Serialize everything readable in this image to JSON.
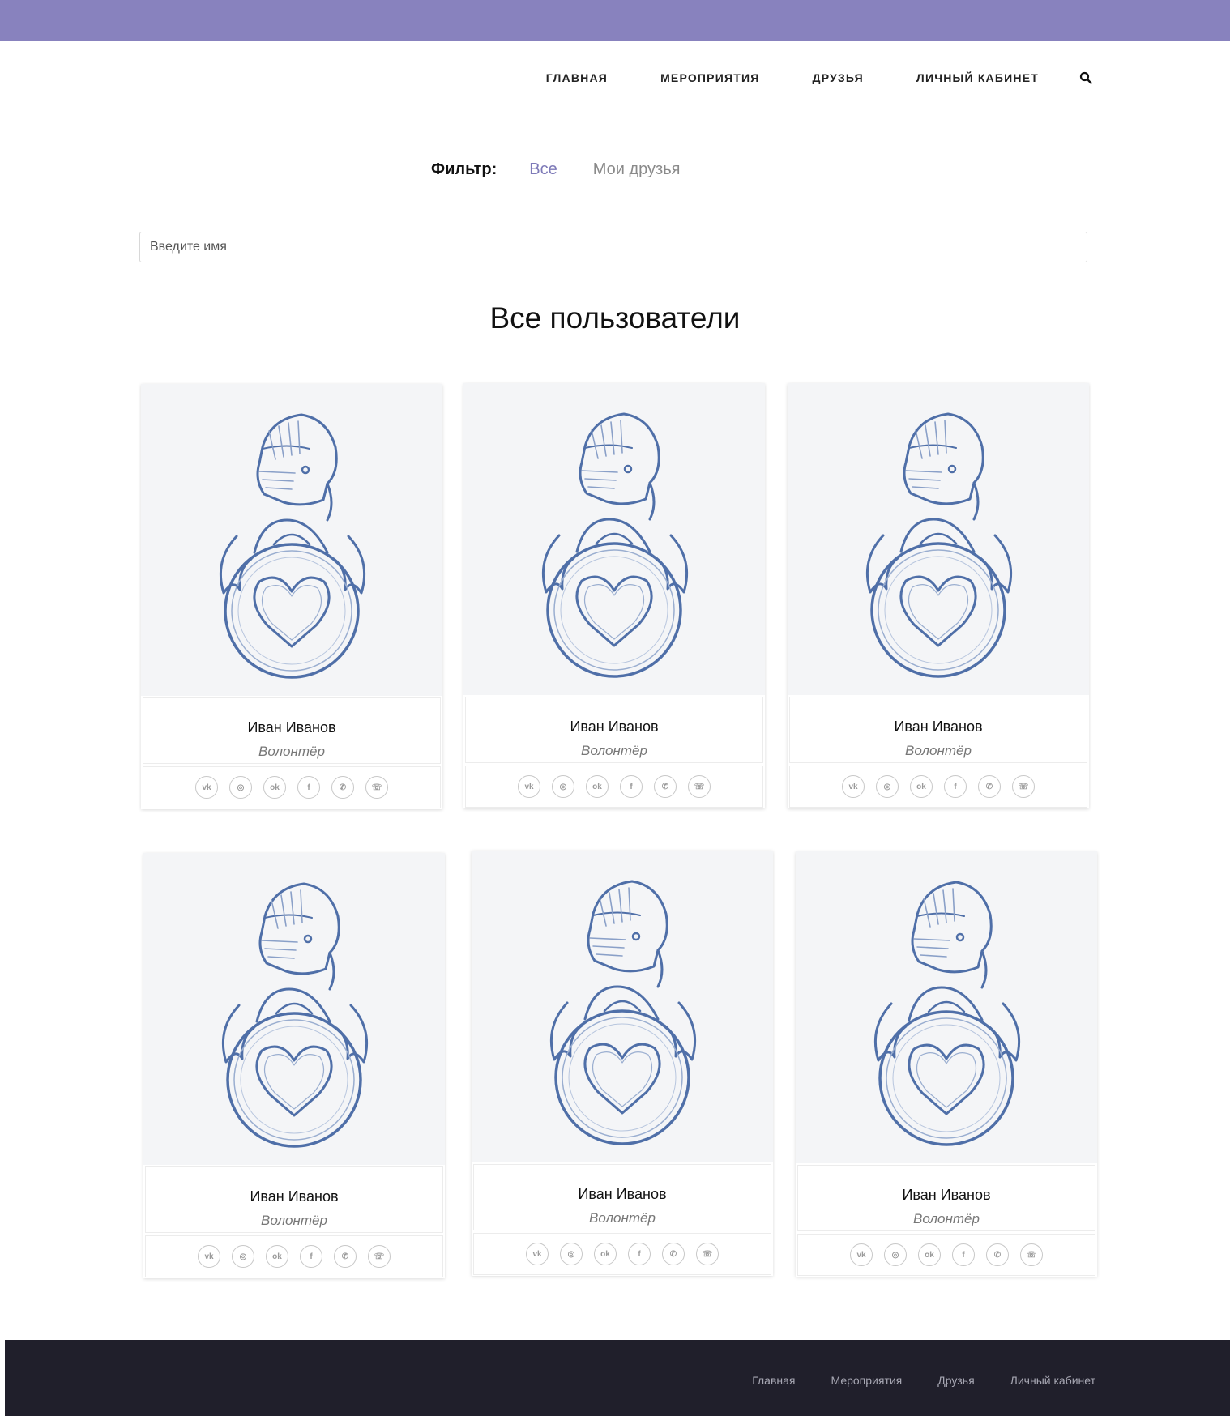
{
  "colors": {
    "accent": "#8882be",
    "active_filter": "#7e7ab8",
    "footer_bg": "#201f2b",
    "photo_bg": "#f4f5f7"
  },
  "nav": {
    "items": [
      "ГЛАВНАЯ",
      "МЕРОПРИЯТИЯ",
      "ДРУЗЬЯ",
      "ЛИЧНЫЙ КАБИНЕТ"
    ],
    "search_icon": "search-icon"
  },
  "filter": {
    "label": "Фильтр:",
    "options": [
      "Все",
      "Мои друзья"
    ],
    "active": "Все"
  },
  "search": {
    "placeholder": "Введите имя",
    "value": ""
  },
  "page_title": "Все пользователи",
  "socials": [
    {
      "name": "vk-icon",
      "glyph": "vk"
    },
    {
      "name": "instagram-icon",
      "glyph": "◎"
    },
    {
      "name": "odnoklassniki-icon",
      "glyph": "ok"
    },
    {
      "name": "facebook-icon",
      "glyph": "f"
    },
    {
      "name": "whatsapp-icon",
      "glyph": "✆"
    },
    {
      "name": "viber-icon",
      "glyph": "☏"
    }
  ],
  "users": [
    {
      "name": "Иван Иванов",
      "role": "Волонтёр"
    },
    {
      "name": "Иван Иванов",
      "role": "Волонтёр"
    },
    {
      "name": "Иван Иванов",
      "role": "Волонтёр"
    },
    {
      "name": "Иван Иванов",
      "role": "Волонтёр"
    },
    {
      "name": "Иван Иванов",
      "role": "Волонтёр"
    },
    {
      "name": "Иван Иванов",
      "role": "Волонтёр"
    }
  ],
  "footer": {
    "links": [
      "Главная",
      "Мероприятия",
      "Друзья",
      "Личный кабинет"
    ]
  }
}
